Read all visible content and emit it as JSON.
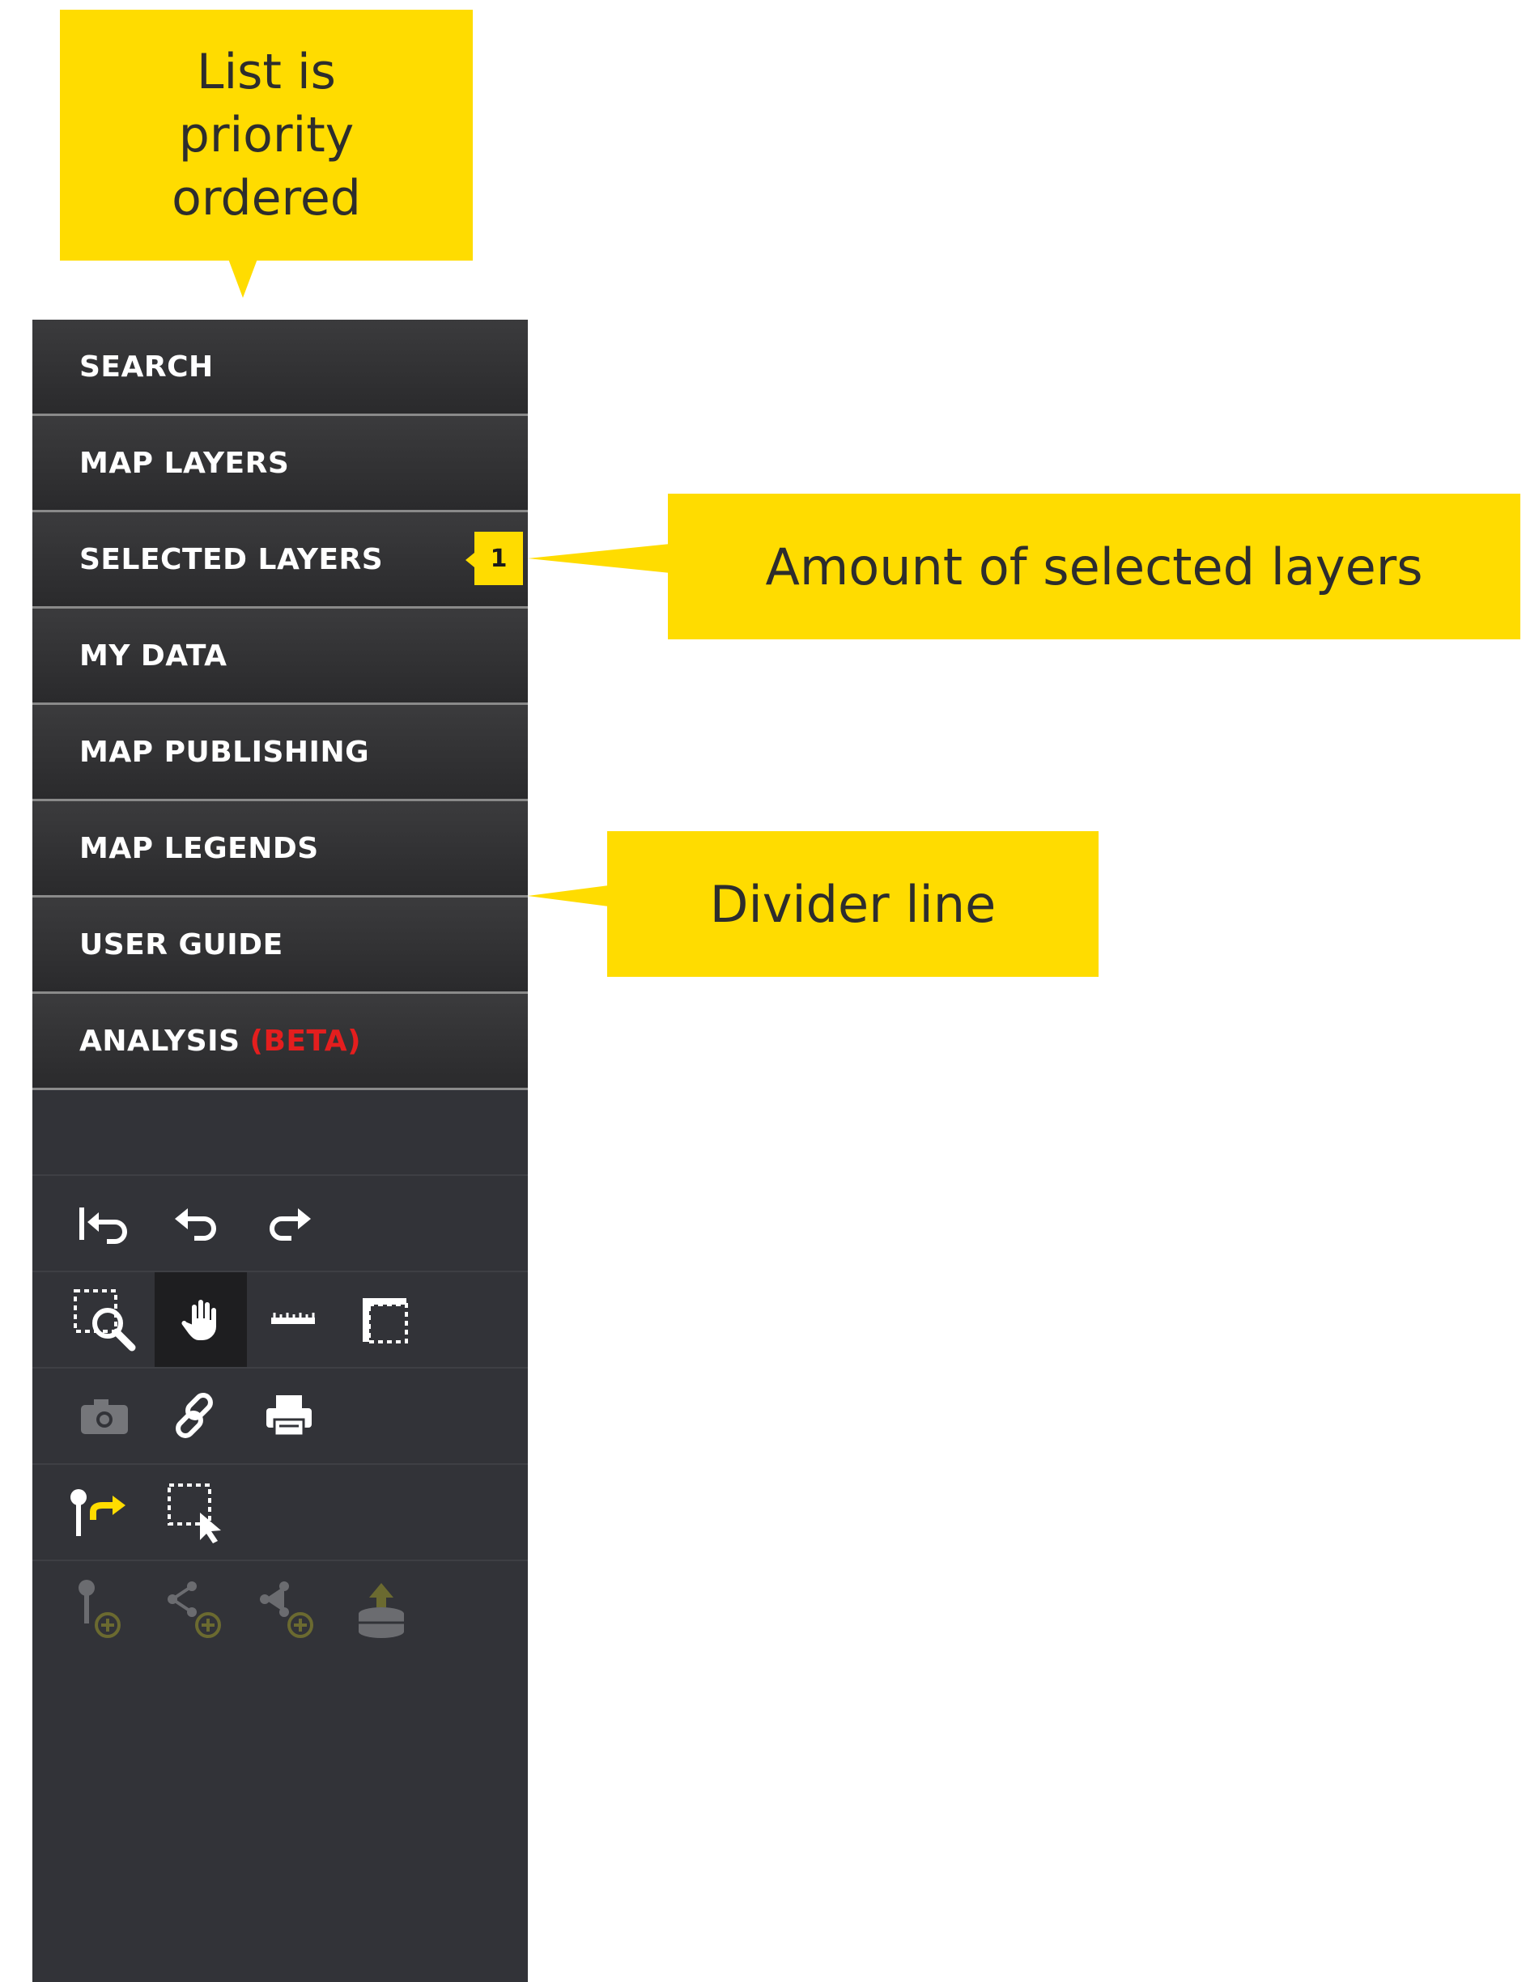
{
  "annotations": {
    "priority": "List is\npriority\nordered",
    "amount": "Amount of selected layers",
    "divider": "Divider line"
  },
  "menu": {
    "items": [
      {
        "label": "SEARCH"
      },
      {
        "label": "MAP LAYERS"
      },
      {
        "label": "SELECTED LAYERS",
        "badge": "1"
      },
      {
        "label": "MY DATA"
      },
      {
        "label": "MAP PUBLISHING"
      },
      {
        "label": "MAP LEGENDS"
      },
      {
        "label": "USER GUIDE"
      },
      {
        "label": "ANALYSIS",
        "suffix": "(BETA)"
      }
    ]
  },
  "toolbar": {
    "rows": [
      [
        "reset-view-icon",
        "undo-icon",
        "redo-icon"
      ],
      [
        "zoom-box-icon",
        "pan-hand-icon",
        "measure-line-icon",
        "measure-area-icon"
      ],
      [
        "camera-icon",
        "link-icon",
        "print-icon"
      ],
      [
        "point-coordinates-icon",
        "select-area-icon"
      ],
      [
        "add-point-icon",
        "add-line-icon",
        "add-polygon-icon",
        "upload-data-icon"
      ]
    ],
    "active_tool": "pan-hand-icon"
  },
  "colors": {
    "callout": "#ffdc00",
    "sidebar": "#323338",
    "beta": "#e41e1e"
  }
}
